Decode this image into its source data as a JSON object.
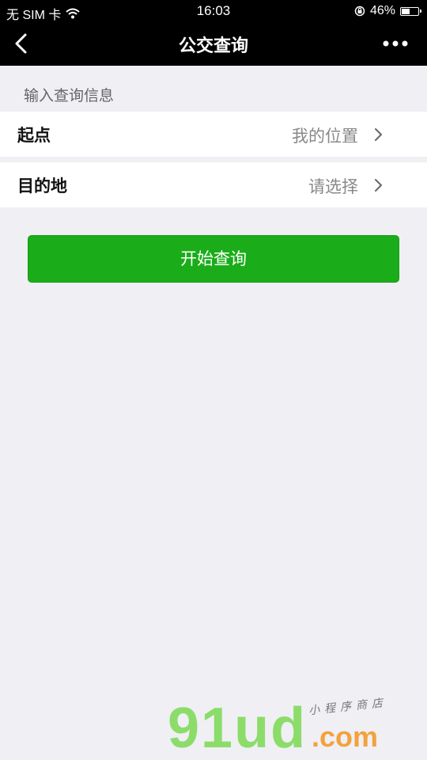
{
  "status_bar": {
    "carrier": "无 SIM 卡",
    "time": "16:03",
    "battery": "46%",
    "battery_level": 0.46,
    "icons": [
      "wifi-icon",
      "rotation-lock-icon",
      "battery-icon"
    ]
  },
  "nav": {
    "title": "公交查询",
    "back_icon": "back-chevron-icon",
    "more_icon": "more-dots-icon"
  },
  "form": {
    "section_header": "输入查询信息",
    "rows": [
      {
        "label": "起点",
        "value": "我的位置"
      },
      {
        "label": "目的地",
        "value": "请选择"
      }
    ]
  },
  "actions": {
    "submit_label": "开始查询"
  },
  "watermark": {
    "logo": "91ud",
    "dotcom": ".com",
    "tagline": "小程序商店"
  },
  "colors": {
    "primary": "#1aad19",
    "nav_bg": "#000000",
    "page_bg": "#efeff4"
  }
}
